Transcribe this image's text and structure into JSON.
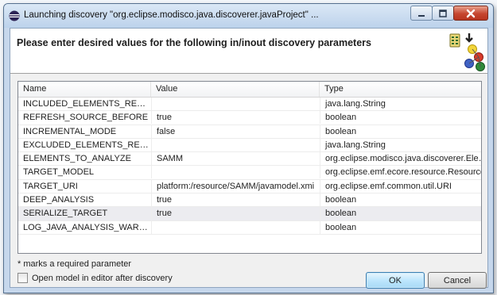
{
  "window": {
    "title": "Launching discovery \"org.eclipse.modisco.java.discoverer.javaProject\" ..."
  },
  "banner": {
    "heading": "Please enter desired values for the following in/inout discovery parameters"
  },
  "table": {
    "columns": [
      "Name",
      "Value",
      "Type"
    ],
    "rows": [
      {
        "name": "INCLUDED_ELEMENTS_REGEX",
        "value": "",
        "type": "java.lang.String"
      },
      {
        "name": "REFRESH_SOURCE_BEFORE",
        "value": "true",
        "type": "boolean"
      },
      {
        "name": "INCREMENTAL_MODE",
        "value": "false",
        "type": "boolean"
      },
      {
        "name": "EXCLUDED_ELEMENTS_REGEX",
        "value": "",
        "type": "java.lang.String"
      },
      {
        "name": "ELEMENTS_TO_ANALYZE",
        "value": "SAMM",
        "type": "org.eclipse.modisco.java.discoverer.Eleme..."
      },
      {
        "name": "TARGET_MODEL",
        "value": "",
        "type": "org.eclipse.emf.ecore.resource.Resource"
      },
      {
        "name": "TARGET_URI",
        "value": "platform:/resource/SAMM/javamodel.xmi",
        "type": "org.eclipse.emf.common.util.URI"
      },
      {
        "name": "DEEP_ANALYSIS",
        "value": "true",
        "type": "boolean"
      },
      {
        "name": "SERIALIZE_TARGET",
        "value": "true",
        "type": "boolean"
      },
      {
        "name": "LOG_JAVA_ANALYSIS_WARNINGS",
        "value": "",
        "type": "boolean"
      }
    ],
    "selected_row": "SERIALIZE_TARGET"
  },
  "footer": {
    "note": "* marks a required parameter",
    "open_model_label": "Open model in editor after discovery",
    "open_model_checked": false,
    "ok_label": "OK",
    "cancel_label": "Cancel"
  },
  "colors": {
    "title_bar": "#c6d7ec",
    "close_button": "#c6462f",
    "selected_row": "#ececf0"
  }
}
